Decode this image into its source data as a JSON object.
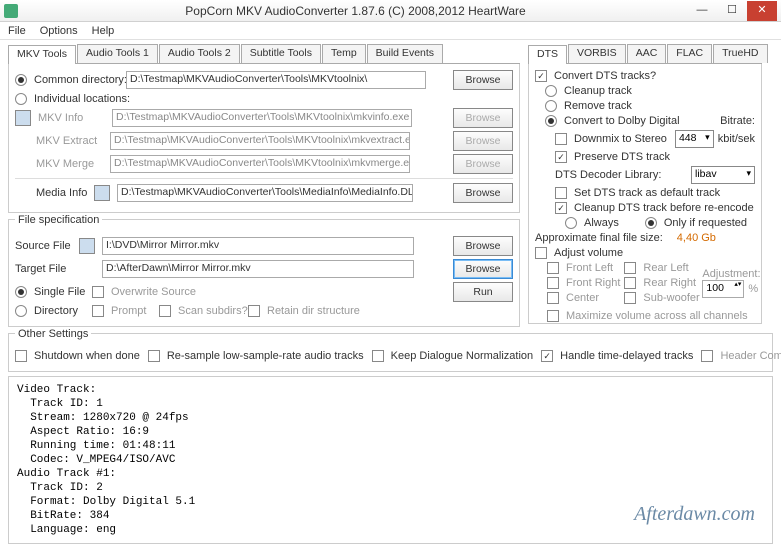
{
  "window": {
    "title": "PopCorn MKV AudioConverter 1.87.6 (C) 2008,2012 HeartWare"
  },
  "menu": {
    "file": "File",
    "options": "Options",
    "help": "Help"
  },
  "leftTabs": [
    "MKV Tools",
    "Audio Tools 1",
    "Audio Tools 2",
    "Subtitle Tools",
    "Temp",
    "Build Events"
  ],
  "rightTabs": [
    "DTS",
    "VORBIS",
    "AAC",
    "FLAC",
    "TrueHD"
  ],
  "mkvTools": {
    "commonDir": "Common directory:",
    "commonDirPath": "D:\\Testmap\\MKVAudioConverter\\Tools\\MKVtoolnix\\",
    "indiv": "Individual locations:",
    "mkvInfo": "MKV Info",
    "mkvInfoPath": "D:\\Testmap\\MKVAudioConverter\\Tools\\MKVtoolnix\\mkvinfo.exe",
    "mkvExtract": "MKV Extract",
    "mkvExtractPath": "D:\\Testmap\\MKVAudioConverter\\Tools\\MKVtoolnix\\mkvextract.exe",
    "mkvMerge": "MKV Merge",
    "mkvMergePath": "D:\\Testmap\\MKVAudioConverter\\Tools\\MKVtoolnix\\mkvmerge.exe",
    "mediaInfo": "Media Info",
    "mediaInfoPath": "D:\\Testmap\\MKVAudioConverter\\Tools\\MediaInfo\\MediaInfo.DLL",
    "browse": "Browse"
  },
  "fileSpec": {
    "title": "File specification",
    "sourceFile": "Source File",
    "sourcePath": "I:\\DVD\\Mirror Mirror.mkv",
    "targetFile": "Target File",
    "targetPath": "D:\\AfterDawn\\Mirror Mirror.mkv",
    "singleFile": "Single File",
    "directory": "Directory",
    "overwrite": "Overwrite Source",
    "prompt": "Prompt",
    "scanSubdirs": "Scan subdirs?",
    "retainDir": "Retain dir structure",
    "browse": "Browse",
    "run": "Run"
  },
  "other": {
    "title": "Other Settings",
    "shutdown": "Shutdown when done",
    "resample": "Re-sample low-sample-rate audio tracks",
    "keepDialogue": "Keep Dialogue Normalization",
    "handleTD": "Handle time-delayed tracks",
    "headerComp": "Header Compression"
  },
  "dts": {
    "convert": "Convert DTS tracks?",
    "cleanup": "Cleanup track",
    "remove": "Remove track",
    "toDolby": "Convert to Dolby Digital",
    "downmix": "Downmix to Stereo",
    "preserve": "Preserve DTS track",
    "decoder": "DTS Decoder Library:",
    "decoderVal": "libav",
    "bitrate": "Bitrate:",
    "bitrateVal": "448",
    "bitrateUnit": "kbit/sek",
    "setDefault": "Set DTS track as default track",
    "cleanupBefore": "Cleanup DTS track before re-encode",
    "always": "Always",
    "onlyReq": "Only if requested",
    "approx": "Approximate final file size:",
    "approxVal": "4,40 Gb",
    "adjVol": "Adjust volume",
    "frontLeft": "Front Left",
    "frontRight": "Front Right",
    "center": "Center",
    "rearLeft": "Rear Left",
    "rearRight": "Rear Right",
    "subwoofer": "Sub-woofer",
    "adjustment": "Adjustment:",
    "adjVal": "100",
    "maximize": "Maximize volume across all channels",
    "pct": "%"
  },
  "info": "Video Track:\n  Track ID: 1\n  Stream: 1280x720 @ 24fps\n  Aspect Ratio: 16:9\n  Running time: 01:48:11\n  Codec: V_MPEG4/ISO/AVC\nAudio Track #1:\n  Track ID: 2\n  Format: Dolby Digital 5.1\n  BitRate: 384\n  Language: eng",
  "watermark": "Afterdawn.com"
}
